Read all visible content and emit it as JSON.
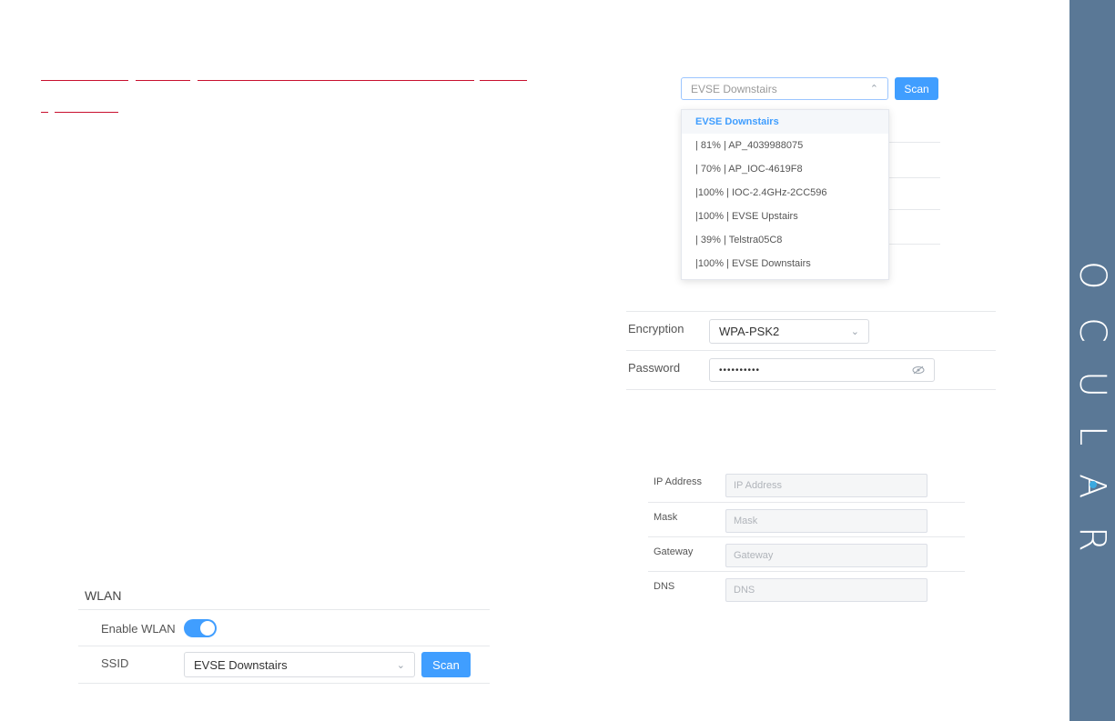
{
  "brand": {
    "name": "OCULAR",
    "letters": [
      "O",
      "C",
      "U",
      "L",
      "A",
      "R"
    ]
  },
  "top_wifi": {
    "ssid_value": "EVSE Downstairs",
    "scan_label": "Scan",
    "networks": [
      "EVSE Downstairs",
      "| 81% | AP_4039988075",
      "| 70% | AP_IOC-4619F8",
      "|100% | IOC-2.4GHz-2CC596",
      "|100% | EVSE Upstairs",
      "| 39% | Telstra05C8",
      "|100% | EVSE Downstairs"
    ]
  },
  "security": {
    "encryption_label": "Encryption",
    "encryption_value": "WPA-PSK2",
    "password_label": "Password",
    "password_value": "••••••••••"
  },
  "ip": {
    "ip_label": "IP Address",
    "ip_placeholder": "IP Address",
    "mask_label": "Mask",
    "mask_placeholder": "Mask",
    "gateway_label": "Gateway",
    "gateway_placeholder": "Gateway",
    "dns_label": "DNS",
    "dns_placeholder": "DNS"
  },
  "wlan": {
    "title": "WLAN",
    "enable_label": "Enable WLAN",
    "enabled": true,
    "ssid_label": "SSID",
    "ssid_value": "EVSE Downstairs",
    "scan_label": "Scan"
  },
  "colors": {
    "brand_bar": "#5a7896",
    "accent": "#409eff",
    "link_red": "#c8102e"
  }
}
